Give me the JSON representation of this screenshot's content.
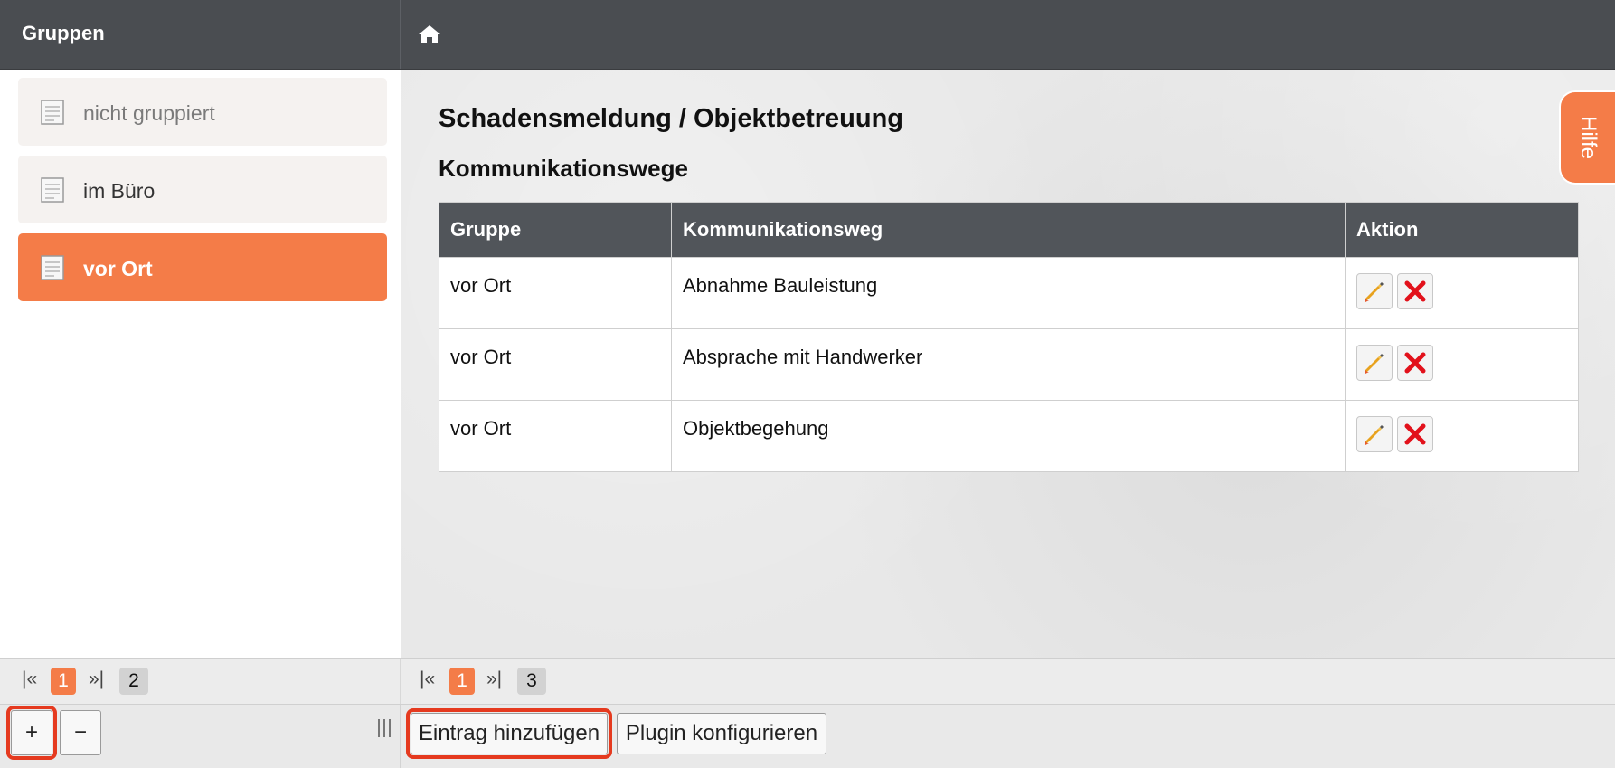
{
  "sidebar": {
    "title": "Gruppen",
    "items": [
      {
        "label": "nicht gruppiert",
        "state": "muted"
      },
      {
        "label": "im Büro",
        "state": "normal"
      },
      {
        "label": "vor Ort",
        "state": "active"
      }
    ],
    "pagination": {
      "first": "|«",
      "current": "1",
      "last": "»|",
      "total": "2"
    },
    "add_label": "+",
    "remove_label": "−"
  },
  "header": {
    "home_icon": "home-icon"
  },
  "main": {
    "page_title": "Schadensmeldung / Objektbetreuung",
    "section_title": "Kommunikationswege",
    "table": {
      "headers": [
        "Gruppe",
        "Kommunikationsweg",
        "Aktion"
      ],
      "rows": [
        {
          "gruppe": "vor Ort",
          "kommunikationsweg": "Abnahme Bauleistung"
        },
        {
          "gruppe": "vor Ort",
          "kommunikationsweg": "Absprache mit Handwerker"
        },
        {
          "gruppe": "vor Ort",
          "kommunikationsweg": "Objektbegehung"
        }
      ],
      "action_icons": [
        "pencil-icon",
        "delete-x-icon"
      ]
    },
    "pagination": {
      "first": "|«",
      "current": "1",
      "last": "»|",
      "total": "3"
    },
    "add_entry_label": "Eintrag hinzufügen",
    "configure_plugin_label": "Plugin konfigurieren"
  },
  "help_tab": {
    "label": "Hilfe"
  },
  "colors": {
    "accent": "#f47c48",
    "header_bg": "#4a4d51",
    "highlight": "#e53a1f",
    "delete": "#e2111b",
    "edit": "#e8a21e"
  }
}
